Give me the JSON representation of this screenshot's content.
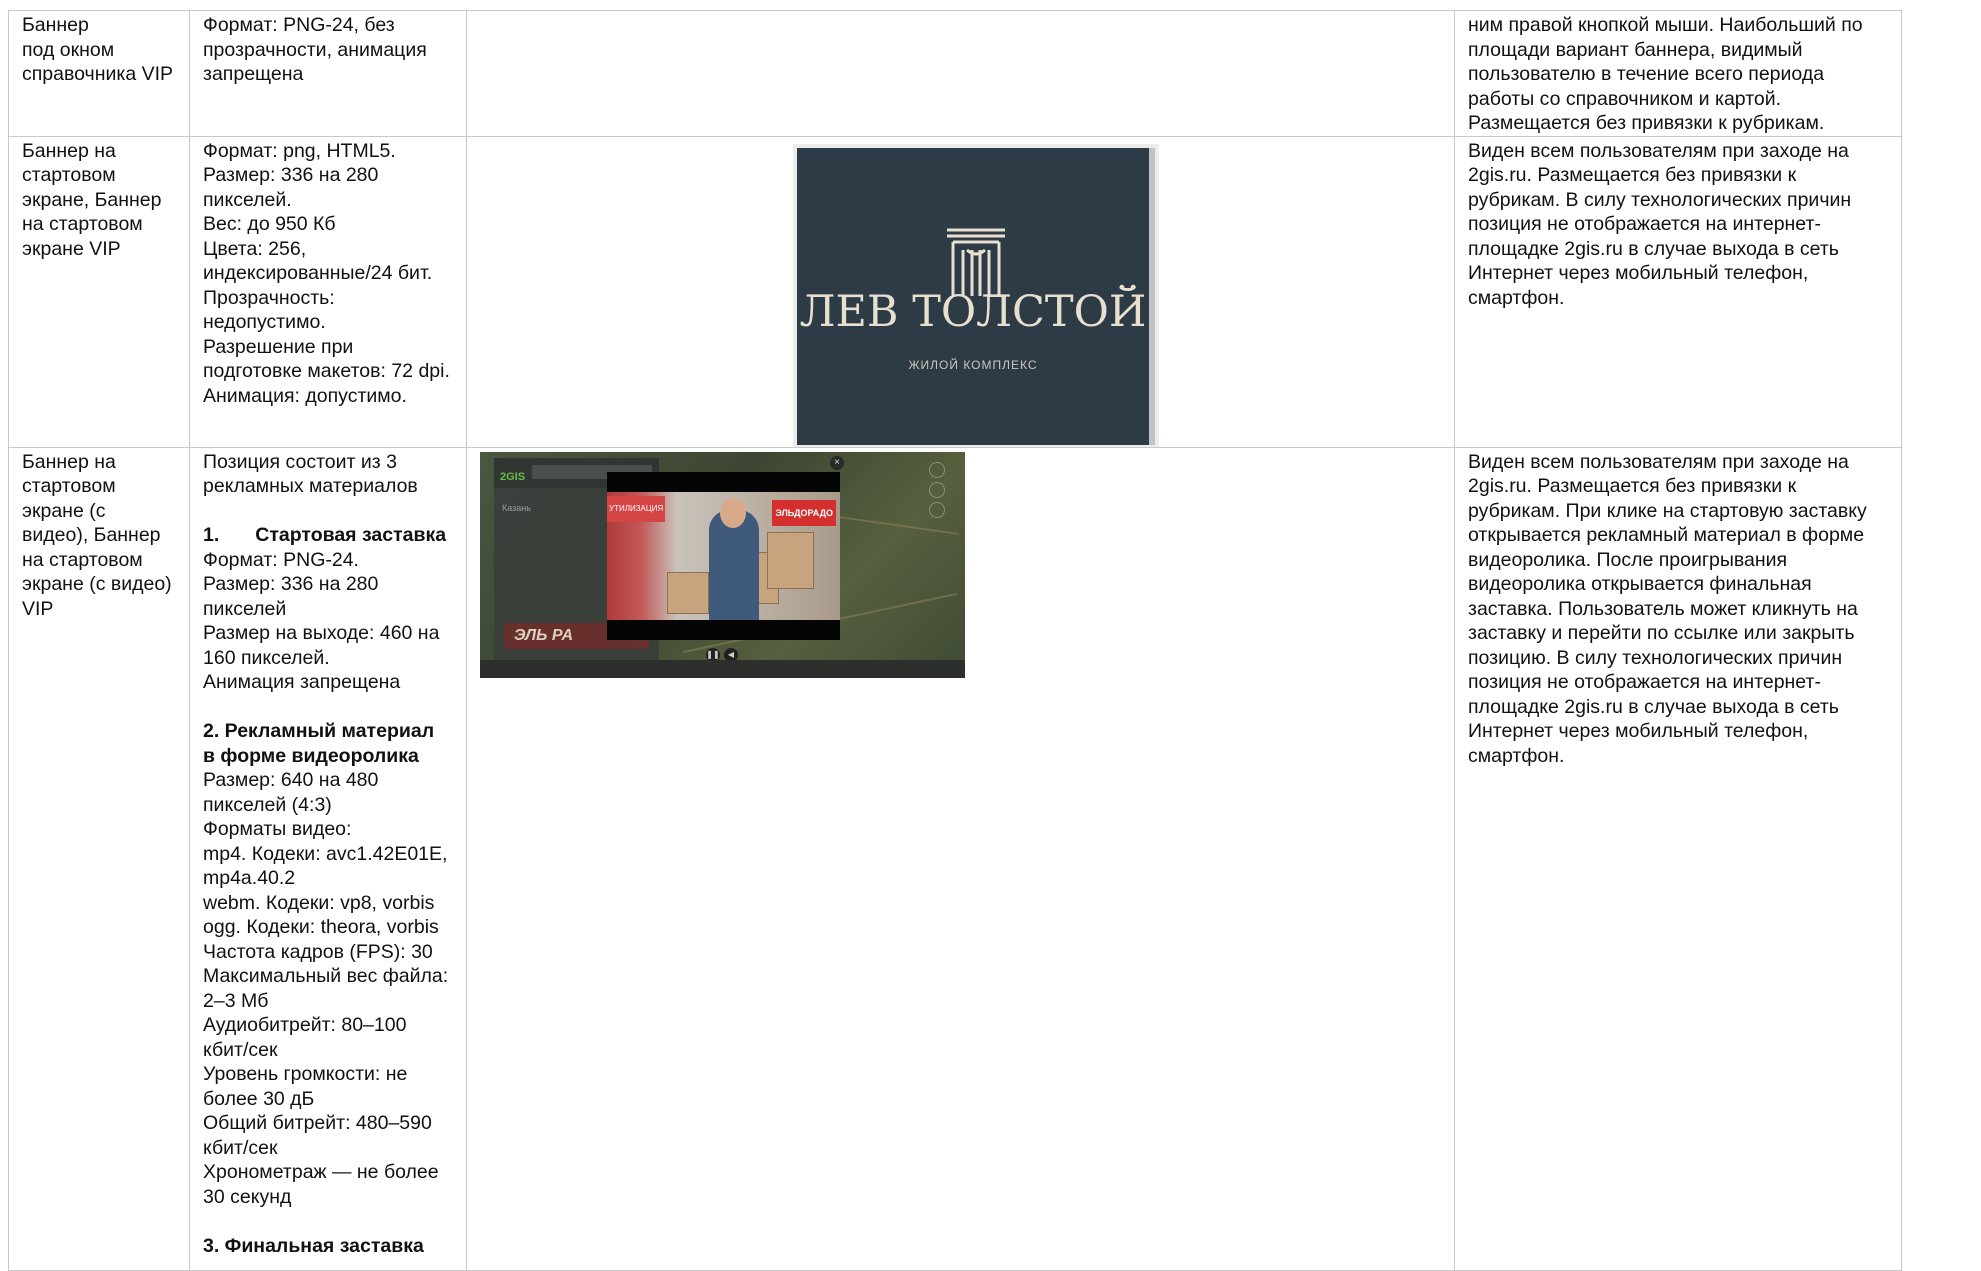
{
  "rows": [
    {
      "position": [
        "Баннер",
        "под окном",
        "справочника VIP"
      ],
      "requirements": [
        {
          "text": "Формат: PNG-24, без"
        },
        {
          "text": "прозрачности, анимация"
        },
        {
          "text": "запрещена"
        }
      ],
      "description": [
        "ним правой кнопкой мыши. Наибольший по",
        "площади вариант баннера, видимый",
        "пользователю в течение всего периода",
        "работы со справочником и картой.",
        "Размещается без привязки к рубрикам."
      ]
    },
    {
      "position": [
        "Баннер на",
        "стартовом",
        "экране, Баннер",
        "на стартовом",
        "экране VIP"
      ],
      "requirements": [
        {
          "text": "Формат: png, HTML5."
        },
        {
          "text": "Размер: 336 на 280"
        },
        {
          "text": "пикселей."
        },
        {
          "text": "Вес: до 950 Кб"
        },
        {
          "text": "Цвета: 256,"
        },
        {
          "text": "индексированные/24 бит."
        },
        {
          "text": "Прозрачность:"
        },
        {
          "text": "недопустимо."
        },
        {
          "text": "Разрешение при"
        },
        {
          "text": "подготовке макетов: 72 dpi."
        },
        {
          "text": "Анимация: допустимо."
        }
      ],
      "banner": {
        "title": "ЛЕВ ТОЛСТОЙ",
        "subtitle": "ЖИЛОЙ КОМПЛЕКС",
        "logo_icon": "columns-logo-icon",
        "bg_color": "#2c3b46"
      },
      "description": [
        "Виден всем пользователям при заходе на",
        "2gis.ru. Размещается без привязки к",
        "рубрикам. В силу технологических причин",
        "позиция не отображается на интернет-",
        "площадке 2gis.ru в случае выхода в сеть",
        "Интернет через мобильный телефон,",
        "смартфон."
      ]
    },
    {
      "position": [
        "Баннер на",
        "стартовом",
        "экране (с",
        "видео), Баннер",
        "на стартовом",
        "экране (с видео)",
        "VIP"
      ],
      "requirements": [
        {
          "text": "Позиция состоит из 3"
        },
        {
          "text": "рекламных материалов"
        },
        {
          "text": ""
        },
        {
          "num": "1.",
          "text": "Стартовая заставка",
          "bold": true
        },
        {
          "text": "Формат: PNG-24."
        },
        {
          "text": "Размер: 336 на 280"
        },
        {
          "text": "пикселей"
        },
        {
          "text": "Размер на выходе: 460 на"
        },
        {
          "text": "160 пикселей."
        },
        {
          "text": "Анимация запрещена"
        },
        {
          "text": ""
        },
        {
          "text": "2. Рекламный материал",
          "bold": true
        },
        {
          "text": "в форме видеоролика",
          "bold": true
        },
        {
          "text": "Размер: 640 на 480"
        },
        {
          "text": "пикселей (4:3)"
        },
        {
          "text": "Форматы видео:"
        },
        {
          "text": "mp4. Кодеки: avc1.42E01E,"
        },
        {
          "text": "mp4a.40.2"
        },
        {
          "text": "webm. Кодеки: vp8, vorbis"
        },
        {
          "text": "ogg. Кодеки: theora, vorbis"
        },
        {
          "text": "Частота кадров (FPS): 30"
        },
        {
          "text": "Максимальный вес файла:"
        },
        {
          "text": "2–3 Мб"
        },
        {
          "text": "Аудиобитрейт: 80–100"
        },
        {
          "text": "кбит/сек"
        },
        {
          "text": "Уровень громкости: не"
        },
        {
          "text": "более 30 дБ"
        },
        {
          "text": "Общий битрейт: 480–590"
        },
        {
          "text": "кбит/сек"
        },
        {
          "text": "Хронометраж — не более"
        },
        {
          "text": "30 секунд"
        },
        {
          "text": ""
        },
        {
          "text": "3. Финальная заставка",
          "bold": true
        }
      ],
      "video": {
        "app_logo": "2GIS",
        "city": "Казань",
        "sidebar_ad": "ЭЛЬ РА",
        "brand_tag": "ЭЛЬДОРАДО",
        "side_tag": "УТИЛИЗАЦИЯ",
        "close_glyph": "×",
        "pause_glyph": "❚❚",
        "volume_glyph": "◀",
        "url": "eldorado.ru/utili"
      },
      "description": [
        "Виден всем пользователям при заходе на",
        "2gis.ru. Размещается без привязки к",
        "рубрикам. При клике на стартовую заставку",
        "открывается рекламный материал в форме",
        "видеоролика. После проигрывания",
        "видеоролика открывается финальная",
        "заставка. Пользователь может кликнуть на",
        "заставку и перейти по ссылке или закрыть",
        "позицию. В силу технологических причин",
        "позиция не отображается на интернет-",
        "площадке 2gis.ru в случае выхода в сеть",
        "Интернет через мобильный телефон,",
        "смартфон."
      ]
    }
  ]
}
